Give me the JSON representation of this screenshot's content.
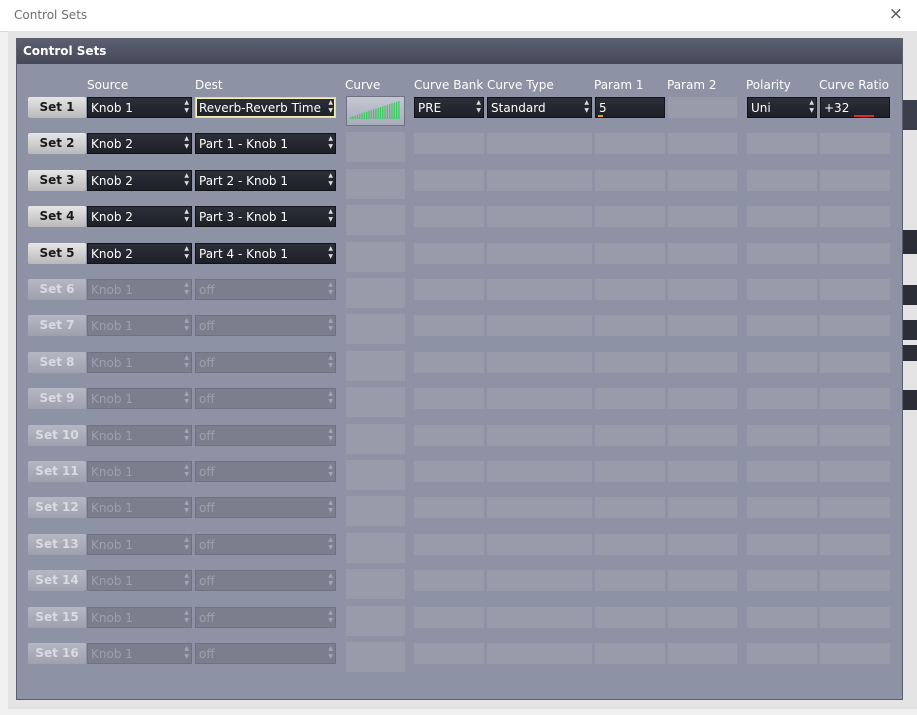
{
  "window": {
    "title": "Control Sets",
    "close_icon": "×"
  },
  "panel": {
    "title": "Control Sets"
  },
  "columns": {
    "source": "Source",
    "dest": "Dest",
    "curve": "Curve",
    "curve_bank": "Curve Bank",
    "curve_type": "Curve Type",
    "param1": "Param 1",
    "param2": "Param 2",
    "polarity": "Polarity",
    "curve_ratio": "Curve Ratio"
  },
  "sets": [
    {
      "label": "Set 1",
      "source": "Knob 1",
      "dest": "Reverb-Reverb Time",
      "enabled": true
    },
    {
      "label": "Set 2",
      "source": "Knob 2",
      "dest": "Part 1 - Knob 1",
      "enabled": true
    },
    {
      "label": "Set 3",
      "source": "Knob 2",
      "dest": "Part 2 - Knob 1",
      "enabled": true
    },
    {
      "label": "Set 4",
      "source": "Knob 2",
      "dest": "Part 3 - Knob 1",
      "enabled": true
    },
    {
      "label": "Set 5",
      "source": "Knob 2",
      "dest": "Part 4 - Knob 1",
      "enabled": true
    },
    {
      "label": "Set 6",
      "source": "Knob 1",
      "dest": "off",
      "enabled": false
    },
    {
      "label": "Set 7",
      "source": "Knob 1",
      "dest": "off",
      "enabled": false
    },
    {
      "label": "Set 8",
      "source": "Knob 1",
      "dest": "off",
      "enabled": false
    },
    {
      "label": "Set 9",
      "source": "Knob 1",
      "dest": "off",
      "enabled": false
    },
    {
      "label": "Set 10",
      "source": "Knob 1",
      "dest": "off",
      "enabled": false
    },
    {
      "label": "Set 11",
      "source": "Knob 1",
      "dest": "off",
      "enabled": false
    },
    {
      "label": "Set 12",
      "source": "Knob 1",
      "dest": "off",
      "enabled": false
    },
    {
      "label": "Set 13",
      "source": "Knob 1",
      "dest": "off",
      "enabled": false
    },
    {
      "label": "Set 14",
      "source": "Knob 1",
      "dest": "off",
      "enabled": false
    },
    {
      "label": "Set 15",
      "source": "Knob 1",
      "dest": "off",
      "enabled": false
    },
    {
      "label": "Set 16",
      "source": "Knob 1",
      "dest": "off",
      "enabled": false
    }
  ],
  "set1_detail": {
    "curve_bank": "PRE",
    "curve_type": "Standard",
    "param1": "5",
    "polarity": "Uni",
    "curve_ratio": "+32"
  },
  "colors": {
    "panel_bg": "#8d92a4",
    "curve_green": "#35c85a",
    "param_meter": "#e6a016",
    "ratio_meter": "#e02a2a"
  }
}
